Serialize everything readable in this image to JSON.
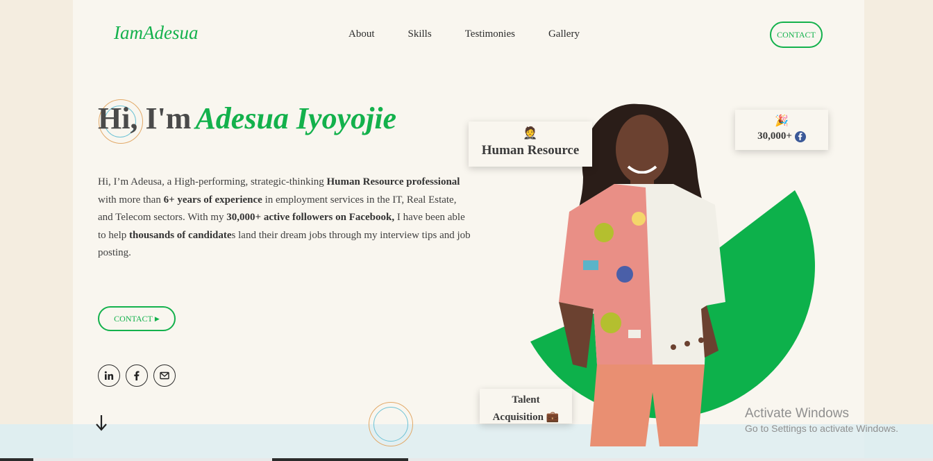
{
  "header": {
    "logo": "IamAdesua",
    "nav": [
      "About",
      "Skills",
      "Testimonies",
      "Gallery"
    ],
    "contact_label": "CONTACT"
  },
  "hero": {
    "greeting": "Hi, I'm",
    "name": "Adesua Iyoyojie",
    "bio": {
      "p1": "Hi, I’m Adeusa, a High-performing, strategic-thinking ",
      "b1": "Human Resource professional",
      "p2": " with more than ",
      "b2": "6+ years of experience",
      "p3": " in employment services in the IT, Real Estate, and Telecom sectors. With my ",
      "b3": "30,000+ active followers on Facebook,",
      "p4": " I have been able to help ",
      "b4": "thousands of candidate",
      "p5": "s land their dream jobs through my interview tips and job posting."
    },
    "contact_label": "CONTACT",
    "socials": [
      "linkedin-icon",
      "facebook-icon",
      "mail-icon"
    ]
  },
  "cards": {
    "hr": {
      "emoji": "🤵",
      "label": "Human Resource"
    },
    "followers": {
      "emoji": "🎉",
      "label": "30,000+"
    },
    "talent": {
      "line1": "Talent",
      "line2": "Acquisition",
      "emoji": "💼"
    }
  },
  "watermark": {
    "title": "Activate Windows",
    "subtitle": "Go to Settings to activate Windows."
  },
  "colors": {
    "accent": "#13b14c",
    "page": "#f9f6ef",
    "band": "#dfeef0"
  }
}
